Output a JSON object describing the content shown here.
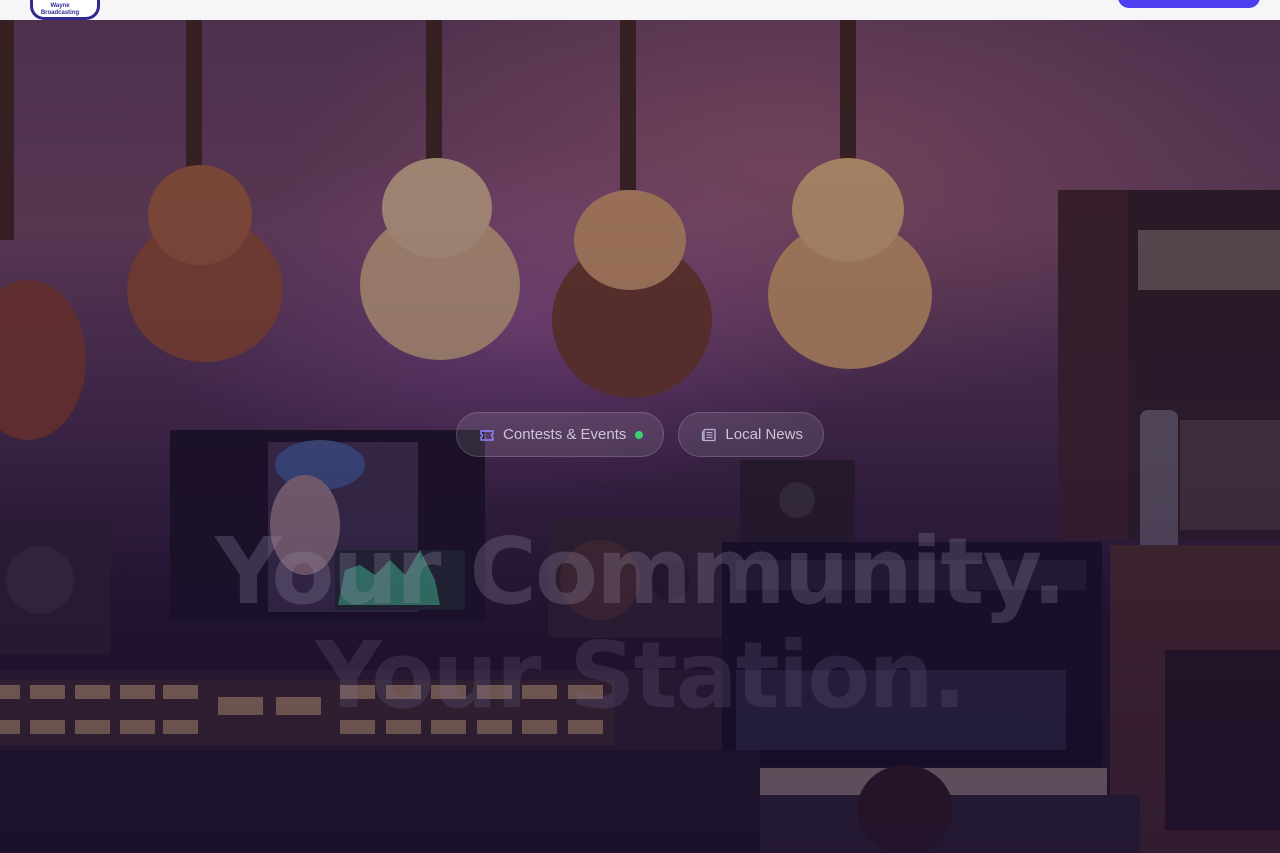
{
  "header": {
    "logo_text": "Wayne\nBroadcasting",
    "cta_label": ""
  },
  "hero": {
    "pills": [
      {
        "label": "Contests & Events",
        "icon": "ticket-icon",
        "has_live_dot": true
      },
      {
        "label": "Local News",
        "icon": "newspaper-icon",
        "has_live_dot": false
      }
    ],
    "headline_line1": "Your Community.",
    "headline_line2": "Your Station."
  },
  "colors": {
    "brand": "#2e2a8f",
    "cta": "#4b3ff0",
    "live_dot": "#3bd16f"
  }
}
